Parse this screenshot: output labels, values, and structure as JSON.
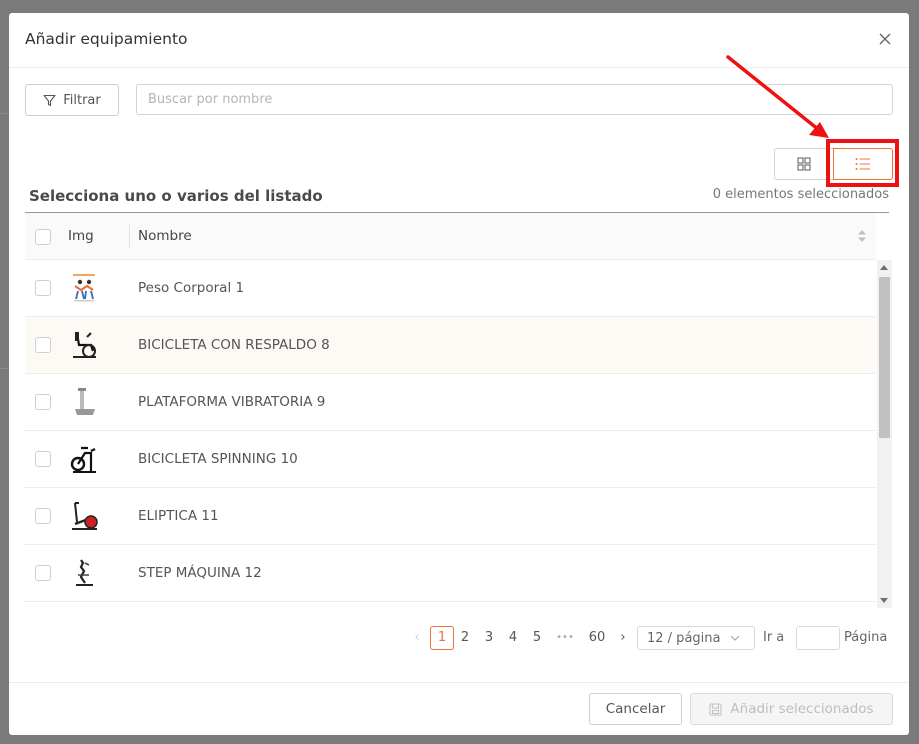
{
  "modal": {
    "title": "Añadir equipamiento"
  },
  "toolbar": {
    "filter_label": "Filtrar",
    "search_placeholder": "Buscar por nombre",
    "search_value": ""
  },
  "view_toggle": {
    "active": "list",
    "accent_color": "#e8743b",
    "highlight_color": "#ee1111"
  },
  "list": {
    "title": "Selecciona uno o varios del listado",
    "selected_count_text": "0 elementos seleccionados",
    "columns": {
      "img": "Img",
      "name": "Nombre"
    },
    "rows": [
      {
        "name": "Peso Corporal 1",
        "icon": "bodyweight-exercise-icon"
      },
      {
        "name": "BICICLETA CON RESPALDO 8",
        "icon": "recumbent-bike-icon"
      },
      {
        "name": "PLATAFORMA VIBRATORIA 9",
        "icon": "vibration-platform-icon"
      },
      {
        "name": "BICICLETA SPINNING 10",
        "icon": "spinning-bike-icon"
      },
      {
        "name": "ELIPTICA 11",
        "icon": "elliptical-icon"
      },
      {
        "name": "STEP MÁQUINA 12",
        "icon": "step-machine-icon"
      }
    ]
  },
  "pagination": {
    "pages": [
      "1",
      "2",
      "3",
      "4",
      "5"
    ],
    "ellipsis": "•••",
    "last_page": "60",
    "current": "1",
    "page_size": "12 / página",
    "goto_label": "Ir a",
    "goto_suffix": "Página"
  },
  "footer": {
    "cancel_label": "Cancelar",
    "add_label": "Añadir seleccionados"
  }
}
